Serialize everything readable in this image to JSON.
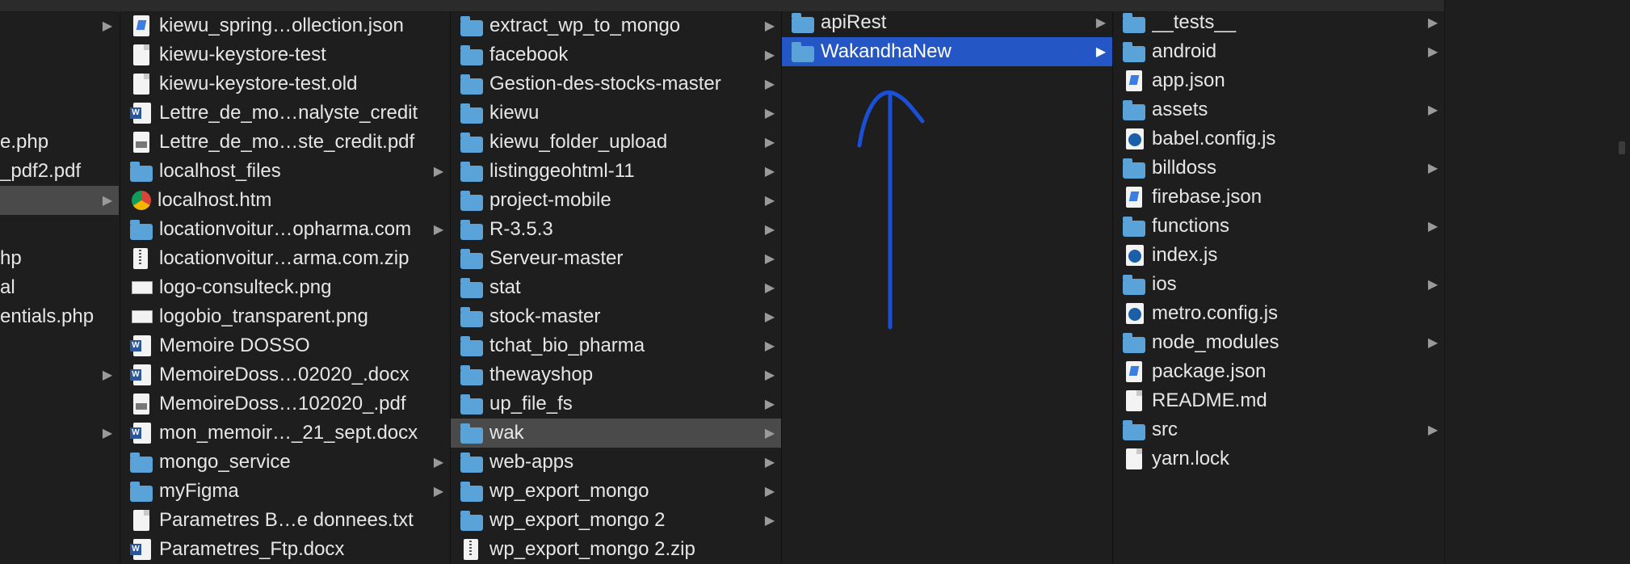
{
  "col1": {
    "rows": [
      {
        "label": "",
        "chevron": true
      },
      {
        "label": ""
      },
      {
        "label": ""
      },
      {
        "label": ""
      },
      {
        "label": "e.php"
      },
      {
        "label": "_pdf2.pdf"
      },
      {
        "label": "",
        "chevron": true,
        "highlight": true
      },
      {
        "label": ""
      },
      {
        "label": "hp"
      },
      {
        "label": "al"
      },
      {
        "label": "entials.php"
      },
      {
        "label": ""
      },
      {
        "label": "",
        "chevron": true
      },
      {
        "label": ""
      },
      {
        "label": "",
        "chevron": true
      }
    ]
  },
  "col2": {
    "rows": [
      {
        "label": "kiewu_spring…ollection.json",
        "icon": "json-file-icon"
      },
      {
        "label": "kiewu-keystore-test",
        "icon": "document-icon"
      },
      {
        "label": "kiewu-keystore-test.old",
        "icon": "document-icon"
      },
      {
        "label": "Lettre_de_mo…nalyste_credit",
        "icon": "word-document-icon"
      },
      {
        "label": "Lettre_de_mo…ste_credit.pdf",
        "icon": "pdf-file-icon"
      },
      {
        "label": "localhost_files",
        "icon": "folder-icon",
        "chevron": true
      },
      {
        "label": "localhost.htm",
        "icon": "chrome-icon"
      },
      {
        "label": "locationvoitur…opharma.com",
        "icon": "folder-icon",
        "chevron": true
      },
      {
        "label": "locationvoitur…arma.com.zip",
        "icon": "zip-file-icon"
      },
      {
        "label": "logo-consulteck.png",
        "icon": "image-file-icon"
      },
      {
        "label": "logobio_transparent.png",
        "icon": "image-file-icon"
      },
      {
        "label": "Memoire DOSSO",
        "icon": "word-document-icon"
      },
      {
        "label": "MemoireDoss…02020_.docx",
        "icon": "word-document-icon"
      },
      {
        "label": "MemoireDoss…102020_.pdf",
        "icon": "pdf-file-icon"
      },
      {
        "label": "mon_memoir…_21_sept.docx",
        "icon": "word-document-icon"
      },
      {
        "label": "mongo_service",
        "icon": "folder-icon",
        "chevron": true
      },
      {
        "label": "myFigma",
        "icon": "folder-icon",
        "chevron": true
      },
      {
        "label": "Parametres B…e donnees.txt",
        "icon": "document-icon"
      },
      {
        "label": "Parametres_Ftp.docx",
        "icon": "word-document-icon"
      }
    ]
  },
  "col3": {
    "rows": [
      {
        "label": "extract_wp_to_mongo",
        "icon": "folder-icon",
        "chevron": true
      },
      {
        "label": "facebook",
        "icon": "folder-icon",
        "chevron": true
      },
      {
        "label": "Gestion-des-stocks-master",
        "icon": "folder-icon",
        "chevron": true
      },
      {
        "label": "kiewu",
        "icon": "folder-icon",
        "chevron": true
      },
      {
        "label": "kiewu_folder_upload",
        "icon": "folder-icon",
        "chevron": true
      },
      {
        "label": "listinggeohtml-11",
        "icon": "folder-icon",
        "chevron": true
      },
      {
        "label": "project-mobile",
        "icon": "folder-icon",
        "chevron": true
      },
      {
        "label": "R-3.5.3",
        "icon": "folder-icon",
        "chevron": true
      },
      {
        "label": "Serveur-master",
        "icon": "folder-icon",
        "chevron": true
      },
      {
        "label": "stat",
        "icon": "folder-icon",
        "chevron": true
      },
      {
        "label": "stock-master",
        "icon": "folder-icon",
        "chevron": true
      },
      {
        "label": "tchat_bio_pharma",
        "icon": "folder-icon",
        "chevron": true
      },
      {
        "label": "thewayshop",
        "icon": "folder-icon",
        "chevron": true
      },
      {
        "label": "up_file_fs",
        "icon": "folder-icon",
        "chevron": true
      },
      {
        "label": "wak",
        "icon": "folder-icon",
        "chevron": true,
        "highlight": true
      },
      {
        "label": "web-apps",
        "icon": "folder-icon",
        "chevron": true
      },
      {
        "label": "wp_export_mongo",
        "icon": "folder-icon",
        "chevron": true
      },
      {
        "label": "wp_export_mongo 2",
        "icon": "folder-icon",
        "chevron": true
      },
      {
        "label": "wp_export_mongo 2.zip",
        "icon": "zip-file-icon"
      }
    ]
  },
  "col4": {
    "rows": [
      {
        "label": "apiRest",
        "icon": "folder-icon",
        "chevron": true
      },
      {
        "label": "WakandhaNew",
        "icon": "folder-icon",
        "chevron": true,
        "selected": true
      }
    ]
  },
  "col5": {
    "rows": [
      {
        "label": "__tests__",
        "icon": "folder-icon",
        "chevron": true
      },
      {
        "label": "android",
        "icon": "folder-icon",
        "chevron": true
      },
      {
        "label": "app.json",
        "icon": "json-file-icon"
      },
      {
        "label": "assets",
        "icon": "folder-icon",
        "chevron": true
      },
      {
        "label": "babel.config.js",
        "icon": "js-file-icon"
      },
      {
        "label": "billdoss",
        "icon": "folder-icon",
        "chevron": true
      },
      {
        "label": "firebase.json",
        "icon": "json-file-icon"
      },
      {
        "label": "functions",
        "icon": "folder-icon",
        "chevron": true
      },
      {
        "label": "index.js",
        "icon": "js-file-icon"
      },
      {
        "label": "ios",
        "icon": "folder-icon",
        "chevron": true
      },
      {
        "label": "metro.config.js",
        "icon": "js-file-icon"
      },
      {
        "label": "node_modules",
        "icon": "folder-icon",
        "chevron": true
      },
      {
        "label": "package.json",
        "icon": "json-file-icon"
      },
      {
        "label": "README.md",
        "icon": "document-icon"
      },
      {
        "label": "src",
        "icon": "folder-icon",
        "chevron": true
      },
      {
        "label": "yarn.lock",
        "icon": "document-icon"
      }
    ]
  },
  "colors": {
    "selection": "#2457c5",
    "highlight": "#4a4a4a",
    "folder": "#5aa3d9",
    "annotation": "#1a4fd6"
  },
  "annotation": {
    "type": "hand-drawn-arrow-up"
  }
}
